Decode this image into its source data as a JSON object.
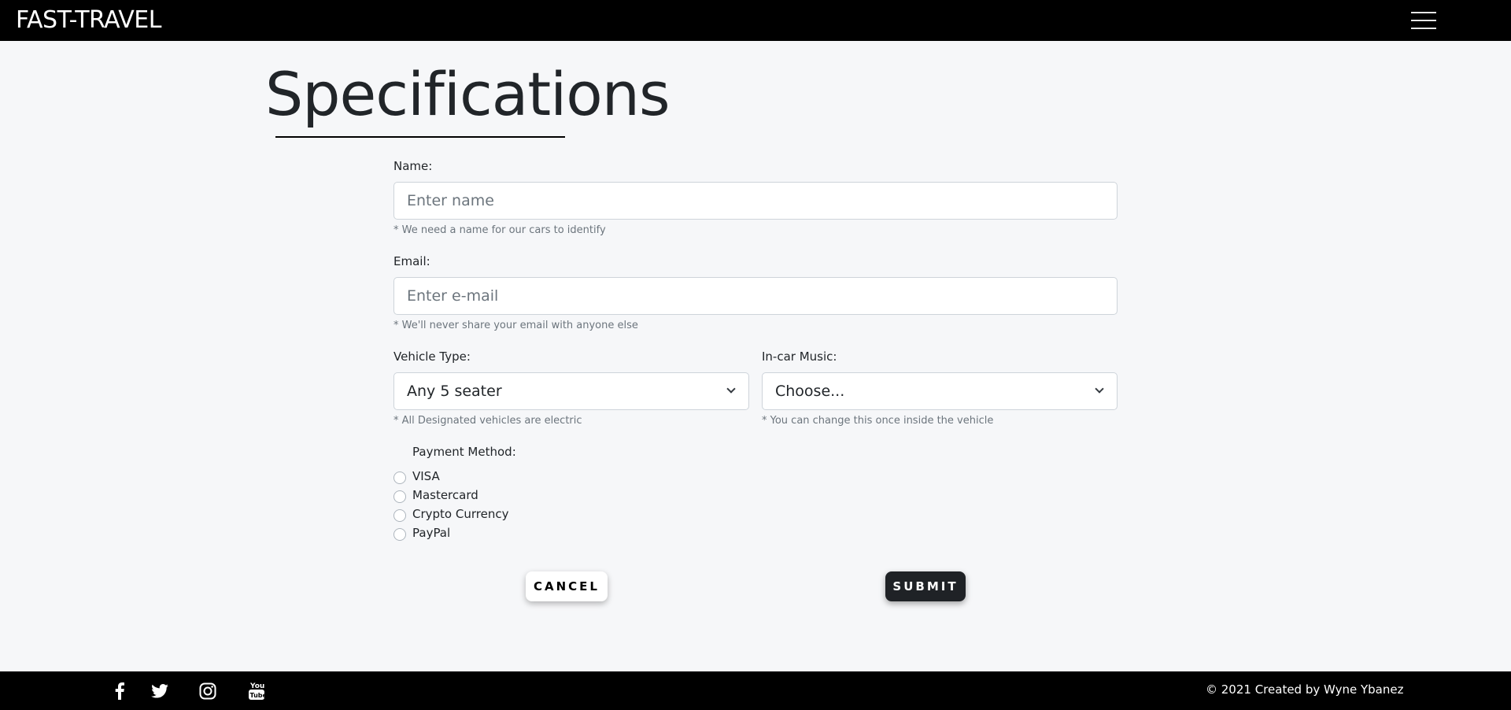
{
  "header": {
    "brand": "FAST-TRAVEL",
    "menu_icon": "hamburger-menu-icon"
  },
  "page": {
    "title": "Specifications"
  },
  "form": {
    "name": {
      "label": "Name:",
      "placeholder": "Enter name",
      "value": "",
      "help": "* We need a name for our cars to identify"
    },
    "email": {
      "label": "Email:",
      "placeholder": "Enter e-mail",
      "value": "",
      "help": "* We'll never share your email with anyone else"
    },
    "vehicle_type": {
      "label": "Vehicle Type:",
      "selected": "Any 5 seater",
      "help": "* All Designated vehicles are electric"
    },
    "in_car_music": {
      "label": "In-car Music:",
      "selected": "Choose...",
      "help": "* You can change this once inside the vehicle"
    },
    "payment": {
      "label": "Payment Method:",
      "options": [
        "VISA",
        "Mastercard",
        "Crypto Currency",
        "PayPal"
      ]
    },
    "cancel_label": "CANCEL",
    "submit_label": "SUBMIT"
  },
  "footer": {
    "social_icons": [
      "facebook-icon",
      "twitter-icon",
      "instagram-icon",
      "youtube-icon"
    ],
    "copyright": "© 2021 Created by Wyne Ybanez"
  },
  "colors": {
    "navbar": "#000000",
    "page_background": "#f6f7f9",
    "submit_button": "#1f2226"
  }
}
